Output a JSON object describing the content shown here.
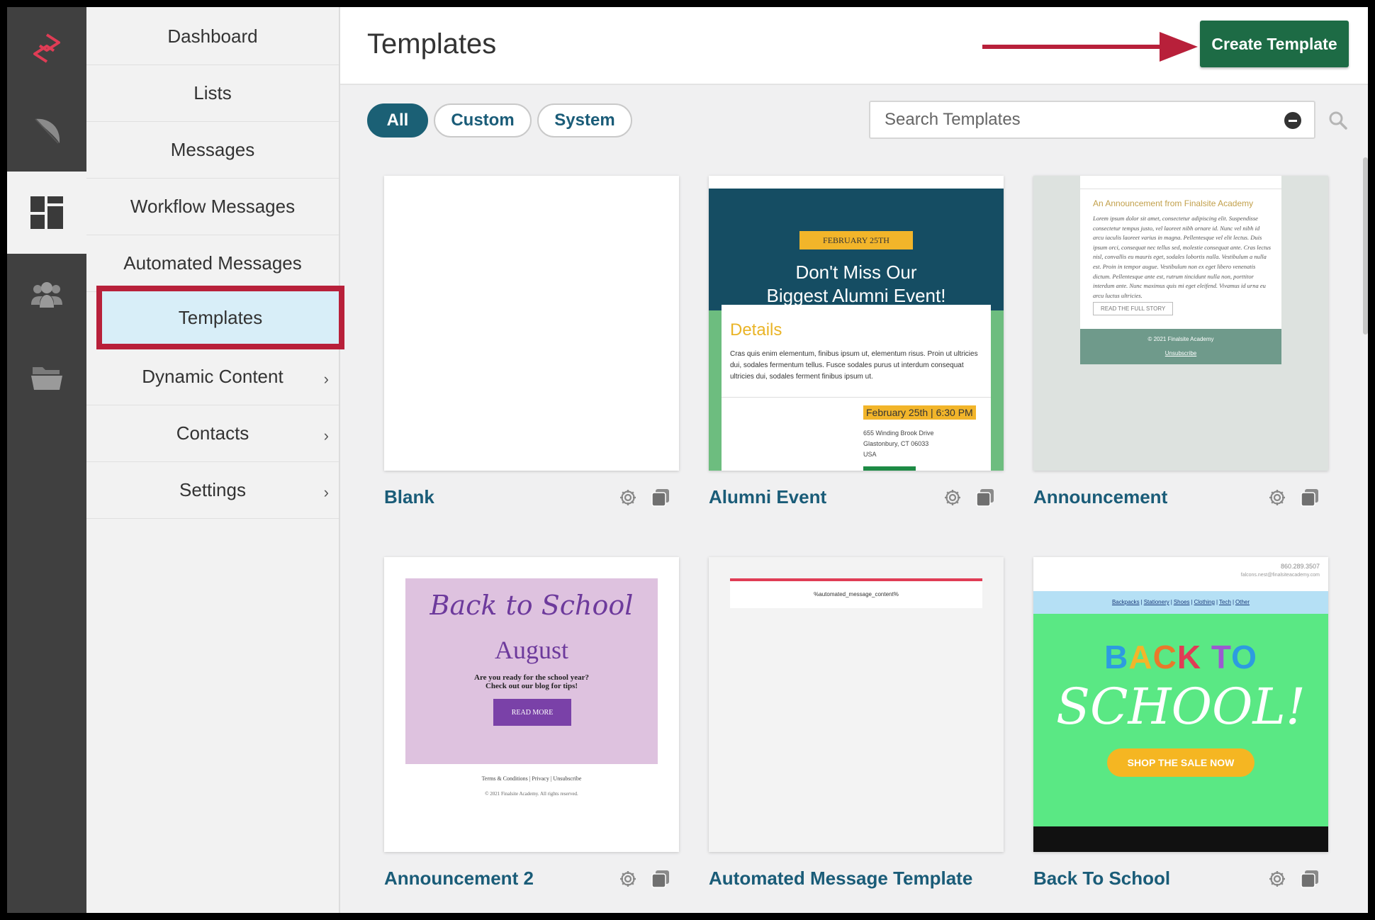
{
  "rail": {
    "items": [
      {
        "icon": "finalsite-logo-icon",
        "color": "#e03c55"
      },
      {
        "icon": "feather-icon"
      },
      {
        "icon": "dashboard-grid-icon",
        "active": true
      },
      {
        "icon": "users-icon"
      },
      {
        "icon": "folder-icon"
      }
    ]
  },
  "nav": {
    "items": [
      {
        "label": "Dashboard"
      },
      {
        "label": "Lists"
      },
      {
        "label": "Messages"
      },
      {
        "label": "Workflow Messages"
      },
      {
        "label": "Automated Messages"
      },
      {
        "label": "Templates",
        "selected": true
      },
      {
        "label": "Dynamic Content",
        "submenu": true
      },
      {
        "label": "Contacts",
        "submenu": true
      },
      {
        "label": "Settings",
        "submenu": true
      }
    ],
    "chevron": "›"
  },
  "header": {
    "title": "Templates",
    "create_label": "Create Template",
    "create_color": "#1d6b45",
    "annotation_arrow_color": "#b8203a"
  },
  "filters": {
    "tabs": [
      {
        "label": "All",
        "active": true
      },
      {
        "label": "Custom"
      },
      {
        "label": "System"
      }
    ]
  },
  "search": {
    "placeholder": "Search Templates",
    "value": ""
  },
  "templates": [
    {
      "name": "Blank"
    },
    {
      "name": "Alumni Event",
      "preview": {
        "badge": "FEBRUARY 25TH",
        "title_line1": "Don't Miss Our",
        "title_line2": "Biggest Alumni Event!",
        "details_heading": "Details",
        "details_text": "Cras quis enim elementum, finibus ipsum ut, elementum risus. Proin ut ultricies dui, sodales fermentum tellus. Fusce sodales purus ut interdum consequat ultricies dui, sodales ferment finibus ipsum ut.",
        "date": "February 25th | 6:30 PM",
        "address_line1": "655 Winding Brook Drive",
        "address_line2": "Glastonbury, CT 06033",
        "address_line3": "USA"
      }
    },
    {
      "name": "Announcement",
      "preview": {
        "heading": "An Announcement from Finalsite Academy",
        "body": "Lorem ipsum dolor sit amet, consectetur adipiscing elit. Suspendisse consectetur tempus justo, vel laoreet nibh ornare id. Nunc vel nibh id arcu iaculis laoreet varius in magna. Pellentesque vel elit lectus. Duis ipsum orci, consequat nec tellus sed, molestie consequat ante. Cras lectus nisl, convallis eu mauris eget, sodales lobortis nulla. Vestibulum a nulla est. Proin in tempor augue. Vestibulum non ex eget libero venenatis dictum. Pellentesque ante est, rutrum tincidunt nulla non, porttitor interdum ante. Nunc maximus quis mi eget eleifend. Vivamus id urna eu arcu luctus ultricies.",
        "button": "READ THE FULL STORY",
        "footer": "© 2021 Finalsite Academy",
        "unsubscribe": "Unsubscribe"
      }
    },
    {
      "name": "Announcement 2",
      "preview": {
        "script": "Back to School",
        "month": "August",
        "question_line1": "Are you ready for the school year?",
        "question_line2": "Check out our blog for tips!",
        "button": "READ MORE",
        "footer": "Terms & Conditions | Privacy | Unsubscribe",
        "copyright": "© 2021 Finalsite Academy. All rights reserved."
      }
    },
    {
      "name": "Automated Message Template",
      "preview": {
        "placeholder": "%automated_message_content%"
      }
    },
    {
      "name": "Back To School",
      "preview": {
        "phone": "860.289.3507",
        "email": "falcons.nest@finalsiteacademy.com",
        "nav": [
          "Backpacks",
          "Stationery",
          "Shoes",
          "Clothing",
          "Tech",
          "Other"
        ],
        "back_letters": [
          {
            "ch": "B",
            "color": "#2d9be0"
          },
          {
            "ch": "A",
            "color": "#f2b52a"
          },
          {
            "ch": "C",
            "color": "#e8792b"
          },
          {
            "ch": "K",
            "color": "#e03c55"
          },
          {
            "ch": " ",
            "color": "#ffffff"
          },
          {
            "ch": "T",
            "color": "#9b59d0"
          },
          {
            "ch": "O",
            "color": "#2d9be0"
          }
        ],
        "school": "SCHOOL!",
        "button": "SHOP THE SALE NOW"
      }
    }
  ]
}
